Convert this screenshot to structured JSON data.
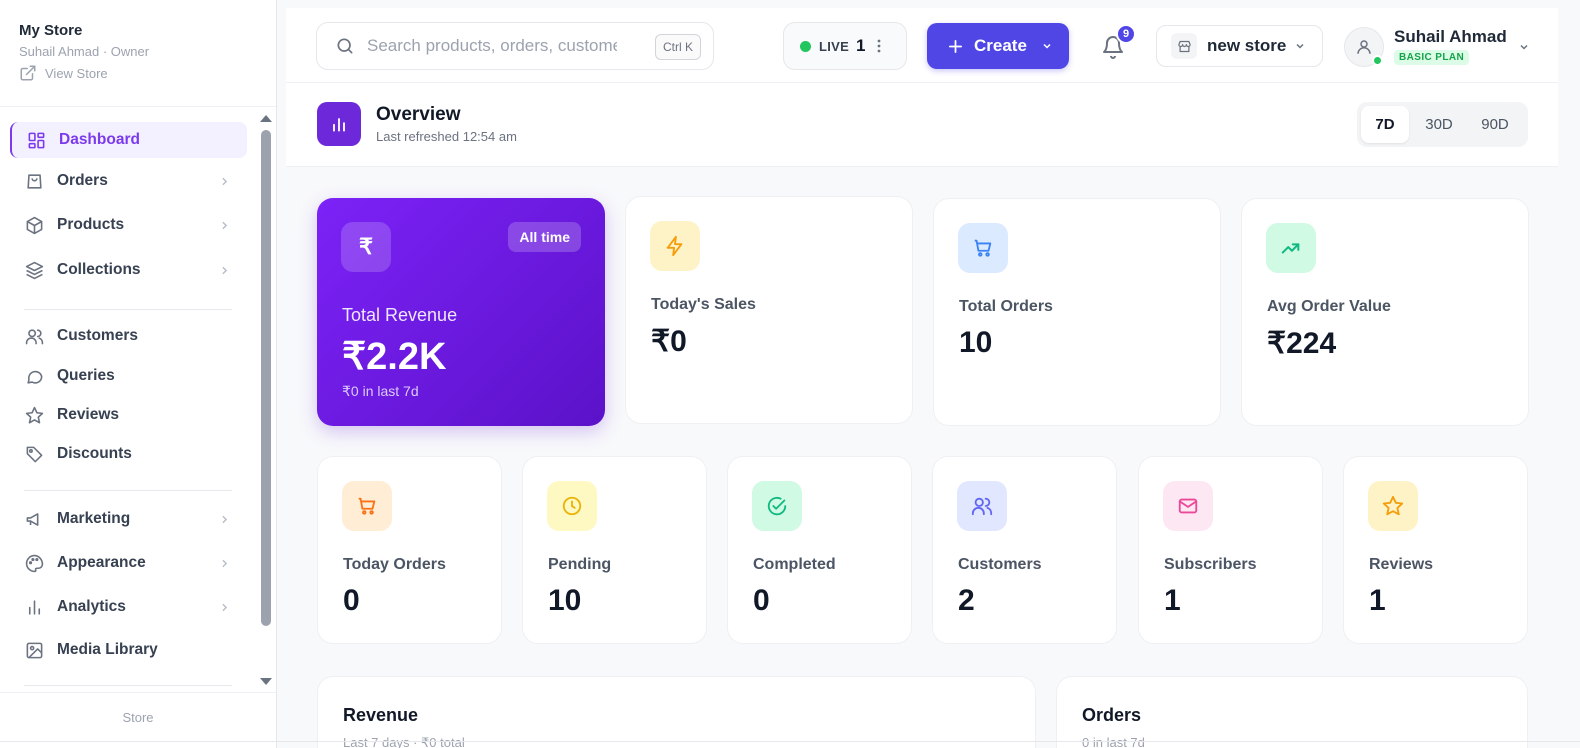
{
  "sidebar": {
    "store_name": "My Store",
    "owner": "Suhail Ahmad · Owner",
    "view_store": "View Store",
    "items": [
      {
        "label": "Dashboard",
        "icon": "dashboard-grid-icon",
        "active": true
      },
      {
        "label": "Orders",
        "icon": "bag-icon",
        "chevron": true
      },
      {
        "label": "Products",
        "icon": "package-icon",
        "chevron": true
      },
      {
        "label": "Collections",
        "icon": "layers-icon",
        "chevron": true
      },
      {
        "label": "Customers",
        "icon": "users-icon"
      },
      {
        "label": "Queries",
        "icon": "chat-bubble-icon"
      },
      {
        "label": "Reviews",
        "icon": "star-icon"
      },
      {
        "label": "Discounts",
        "icon": "tag-icon"
      },
      {
        "label": "Marketing",
        "icon": "megaphone-icon",
        "chevron": true
      },
      {
        "label": "Appearance",
        "icon": "palette-icon",
        "chevron": true
      },
      {
        "label": "Analytics",
        "icon": "bar-chart-icon",
        "chevron": true
      },
      {
        "label": "Media Library",
        "icon": "image-icon"
      }
    ],
    "footer": "Store"
  },
  "topbar": {
    "search_placeholder": "Search products, orders, customers...",
    "shortcut": "Ctrl K",
    "live_label": "LIVE",
    "live_count": "1",
    "create_label": "Create",
    "notifications_count": "9",
    "store_selector": "new store",
    "user_name": "Suhail Ahmad",
    "plan": "BASIC PLAN"
  },
  "overview": {
    "title": "Overview",
    "subtitle": "Last refreshed 12:54 am",
    "ranges": [
      "7D",
      "30D",
      "90D"
    ],
    "selected_range": "7D"
  },
  "revenue_card": {
    "currency_icon": "₹",
    "badge": "All time",
    "label": "Total Revenue",
    "value": "₹2.2K",
    "sub": "₹0 in last 7d"
  },
  "stats_top": [
    {
      "label": "Today's Sales",
      "value": "₹0",
      "icon": "bolt-icon",
      "color": "#f59e0b"
    },
    {
      "label": "Total Orders",
      "value": "10",
      "icon": "cart-icon",
      "color": "#3b82f6"
    },
    {
      "label": "Avg Order Value",
      "value": "₹224",
      "icon": "trending-up-icon",
      "color": "#10b981"
    }
  ],
  "stats_bottom": [
    {
      "label": "Today Orders",
      "value": "0",
      "icon": "cart-icon",
      "color": "#f97316"
    },
    {
      "label": "Pending",
      "value": "10",
      "icon": "clock-icon",
      "color": "#eab308"
    },
    {
      "label": "Completed",
      "value": "0",
      "icon": "check-circle-icon",
      "color": "#10b981"
    },
    {
      "label": "Customers",
      "value": "2",
      "icon": "users-icon",
      "color": "#6366f1"
    },
    {
      "label": "Subscribers",
      "value": "1",
      "icon": "mail-icon",
      "color": "#ec4899"
    },
    {
      "label": "Reviews",
      "value": "1",
      "icon": "star-icon",
      "color": "#f59e0b"
    }
  ],
  "panels": {
    "revenue_title": "Revenue",
    "revenue_sub": "Last 7 days · ₹0 total",
    "orders_title": "Orders",
    "orders_sub": "0 in last 7d"
  },
  "colors": {
    "accent": "#4f46e5",
    "brand_purple": "#7c3aed",
    "live_green": "#22c55e"
  }
}
